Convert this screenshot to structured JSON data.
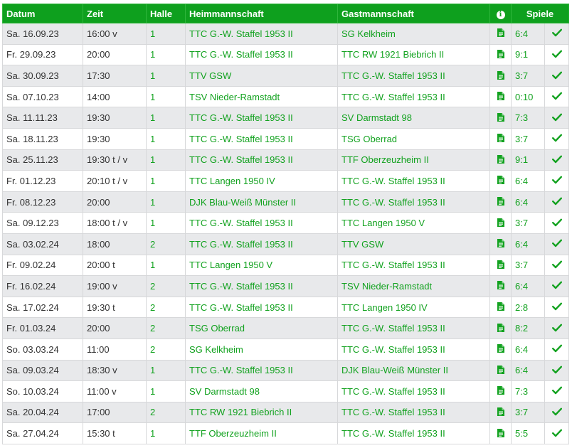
{
  "colors": {
    "header_bg": "#0ea01e",
    "link": "#12a21f",
    "row_alt": "#e8e9eb"
  },
  "icons": {
    "info": "info-icon",
    "report": "document-icon",
    "status": "checkmark-icon"
  },
  "headers": {
    "date": "Datum",
    "time": "Zeit",
    "hall": "Halle",
    "home": "Heimmannschaft",
    "guest": "Gastmannschaft",
    "info_symbol": "i",
    "games": "Spiele"
  },
  "rows": [
    {
      "date": "Sa. 16.09.23",
      "time": "16:00 v",
      "hall": "1",
      "home": "TTC G.-W. Staffel 1953 II",
      "guest": "SG Kelkheim",
      "score": "6:4"
    },
    {
      "date": "Fr. 29.09.23",
      "time": "20:00",
      "hall": "1",
      "home": "TTC G.-W. Staffel 1953 II",
      "guest": "TTC RW 1921 Biebrich II",
      "score": "9:1"
    },
    {
      "date": "Sa. 30.09.23",
      "time": "17:30",
      "hall": "1",
      "home": "TTV GSW",
      "guest": "TTC G.-W. Staffel 1953 II",
      "score": "3:7"
    },
    {
      "date": "Sa. 07.10.23",
      "time": "14:00",
      "hall": "1",
      "home": "TSV Nieder-Ramstadt",
      "guest": "TTC G.-W. Staffel 1953 II",
      "score": "0:10"
    },
    {
      "date": "Sa. 11.11.23",
      "time": "19:30",
      "hall": "1",
      "home": "TTC G.-W. Staffel 1953 II",
      "guest": "SV Darmstadt 98",
      "score": "7:3"
    },
    {
      "date": "Sa. 18.11.23",
      "time": "19:30",
      "hall": "1",
      "home": "TTC G.-W. Staffel 1953 II",
      "guest": "TSG Oberrad",
      "score": "3:7"
    },
    {
      "date": "Sa. 25.11.23",
      "time": "19:30 t / v",
      "hall": "1",
      "home": "TTC G.-W. Staffel 1953 II",
      "guest": "TTF Oberzeuzheim II",
      "score": "9:1"
    },
    {
      "date": "Fr. 01.12.23",
      "time": "20:10 t / v",
      "hall": "1",
      "home": "TTC Langen 1950 IV",
      "guest": "TTC G.-W. Staffel 1953 II",
      "score": "6:4"
    },
    {
      "date": "Fr. 08.12.23",
      "time": "20:00",
      "hall": "1",
      "home": "DJK Blau-Weiß Münster II",
      "guest": "TTC G.-W. Staffel 1953 II",
      "score": "6:4"
    },
    {
      "date": "Sa. 09.12.23",
      "time": "18:00 t / v",
      "hall": "1",
      "home": "TTC G.-W. Staffel 1953 II",
      "guest": "TTC Langen 1950 V",
      "score": "3:7"
    },
    {
      "date": "Sa. 03.02.24",
      "time": "18:00",
      "hall": "2",
      "home": "TTC G.-W. Staffel 1953 II",
      "guest": "TTV GSW",
      "score": "6:4"
    },
    {
      "date": "Fr. 09.02.24",
      "time": "20:00 t",
      "hall": "1",
      "home": "TTC Langen 1950 V",
      "guest": "TTC G.-W. Staffel 1953 II",
      "score": "3:7"
    },
    {
      "date": "Fr. 16.02.24",
      "time": "19:00 v",
      "hall": "2",
      "home": "TTC G.-W. Staffel 1953 II",
      "guest": "TSV Nieder-Ramstadt",
      "score": "6:4"
    },
    {
      "date": "Sa. 17.02.24",
      "time": "19:30 t",
      "hall": "2",
      "home": "TTC G.-W. Staffel 1953 II",
      "guest": "TTC Langen 1950 IV",
      "score": "2:8"
    },
    {
      "date": "Fr. 01.03.24",
      "time": "20:00",
      "hall": "2",
      "home": "TSG Oberrad",
      "guest": "TTC G.-W. Staffel 1953 II",
      "score": "8:2"
    },
    {
      "date": "So. 03.03.24",
      "time": "11:00",
      "hall": "2",
      "home": "SG Kelkheim",
      "guest": "TTC G.-W. Staffel 1953 II",
      "score": "6:4"
    },
    {
      "date": "Sa. 09.03.24",
      "time": "18:30 v",
      "hall": "1",
      "home": "TTC G.-W. Staffel 1953 II",
      "guest": "DJK Blau-Weiß Münster II",
      "score": "6:4"
    },
    {
      "date": "So. 10.03.24",
      "time": "11:00 v",
      "hall": "1",
      "home": "SV Darmstadt 98",
      "guest": "TTC G.-W. Staffel 1953 II",
      "score": "7:3"
    },
    {
      "date": "Sa. 20.04.24",
      "time": "17:00",
      "hall": "2",
      "home": "TTC RW 1921 Biebrich II",
      "guest": "TTC G.-W. Staffel 1953 II",
      "score": "3:7"
    },
    {
      "date": "Sa. 27.04.24",
      "time": "15:30 t",
      "hall": "1",
      "home": "TTF Oberzeuzheim II",
      "guest": "TTC G.-W. Staffel 1953 II",
      "score": "5:5"
    }
  ]
}
